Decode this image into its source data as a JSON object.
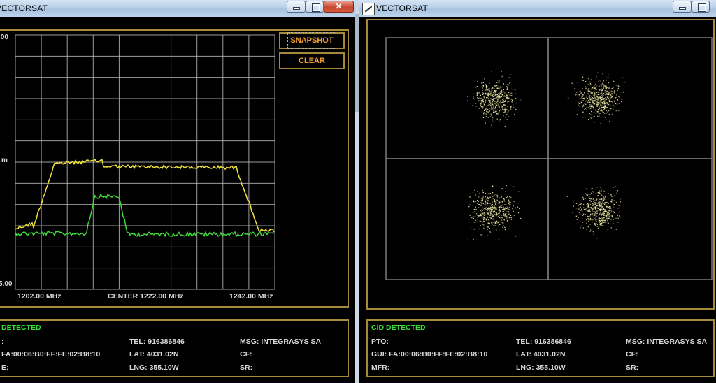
{
  "left_window": {
    "title": "VECTORSAT",
    "titlebar_buttons": {
      "minimize": "minimize",
      "maximize": "maximize",
      "close": "✕"
    },
    "axis": {
      "y_top": ".00",
      "y_mid": "m",
      "y_bottom": "5.00",
      "x_left": "1202.00 MHz",
      "x_center": "CENTER 1222.00 MHz",
      "x_right": "1242.00 MHz"
    },
    "buttons": {
      "snapshot": "SNAPSHOT",
      "clear": "CLEAR"
    },
    "status": {
      "header": "DETECTED",
      "gui_value": "FA:00:06:B0:FF:FE:02:B8:10",
      "tel": "TEL:  916386846",
      "lat": "LAT:  4031.02N",
      "lng": "LNG:  355.10W",
      "msg": "MSG:  INTEGRASYS SA",
      "cf": "CF:",
      "sr": "SR:",
      "row1_label": ":",
      "row3_label": "E:"
    },
    "colors": {
      "trace_yellow": "#f2e43c",
      "trace_green": "#3fdd3a",
      "frame": "#a58a37",
      "grid": "#b8b8b8"
    }
  },
  "right_window": {
    "title": "VECTORSAT",
    "status": {
      "header": "CID DETECTED",
      "pto": "PTO:",
      "gui": "GUI:  FA:00:06:B0:FF:FE:02:B8:10",
      "mfr": "MFR:",
      "tel": "TEL:  916386846",
      "lat": "LAT:  4031.02N",
      "lng": "LNG:  355.10W",
      "msg": "MSG:  INTEGRASYS SA",
      "cf": "CF:",
      "sr": "SR:"
    },
    "colors": {
      "dots": "#e9e6a0",
      "crosshair": "#8a8a8a"
    }
  }
}
